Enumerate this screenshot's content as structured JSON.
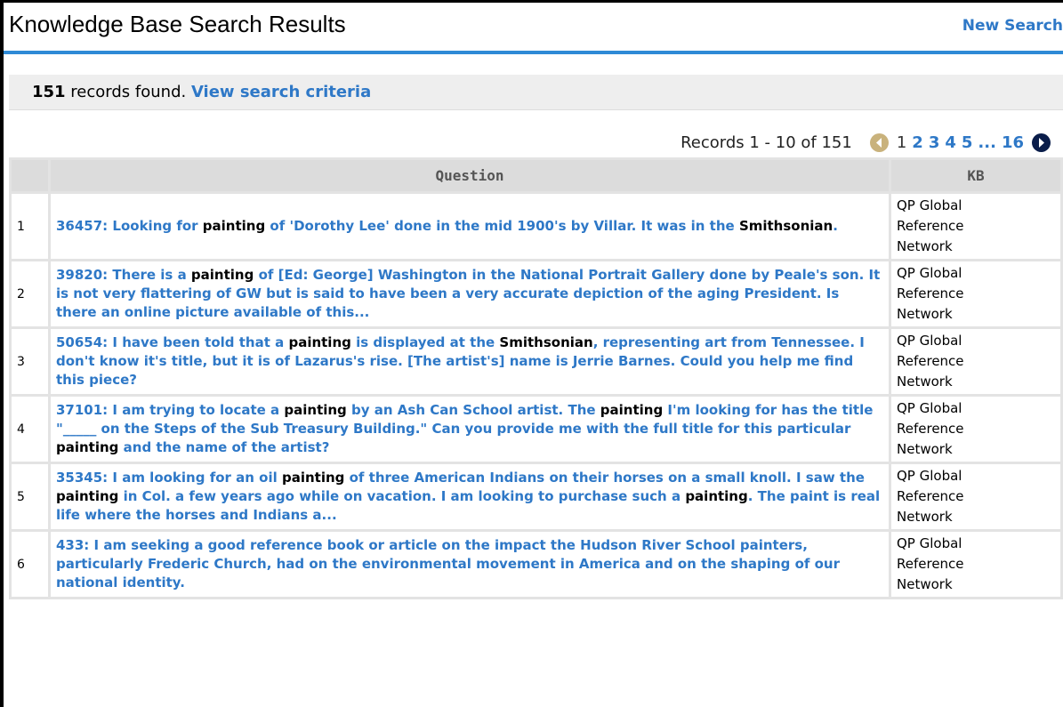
{
  "header": {
    "title": "Knowledge Base Search Results",
    "new_search_label": "New Search"
  },
  "summary": {
    "count": "151",
    "text": " records found. ",
    "criteria_link": "View search criteria"
  },
  "pager": {
    "range_text": "Records 1 - 10 of 151",
    "pages": [
      "1",
      "2",
      "3",
      "4",
      "5"
    ],
    "current_page": "1",
    "ellipsis": "...",
    "last_page": "16",
    "prev_icon": "prev-arrow-icon",
    "next_icon": "next-arrow-icon"
  },
  "table": {
    "columns": {
      "number": "",
      "question": "Question",
      "kb": "KB"
    },
    "rows": [
      {
        "num": "1",
        "segments": [
          {
            "t": "36457: Looking for ",
            "h": false
          },
          {
            "t": "painting",
            "h": true
          },
          {
            "t": " of 'Dorothy Lee' done in the mid 1900's by Villar. It was in the ",
            "h": false
          },
          {
            "t": "Smithsonian",
            "h": true
          },
          {
            "t": ".",
            "h": false
          }
        ],
        "kb": [
          "QP Global",
          "Reference",
          "Network"
        ]
      },
      {
        "num": "2",
        "segments": [
          {
            "t": "39820: There is a ",
            "h": false
          },
          {
            "t": "painting",
            "h": true
          },
          {
            "t": " of [Ed: George] Washington in the National Portrait Gallery done by Peale's son. It is not very flattering of GW but is said to have been a very accurate depiction of the aging President. Is there an online picture available of this...",
            "h": false
          }
        ],
        "kb": [
          "QP Global",
          "Reference",
          "Network"
        ]
      },
      {
        "num": "3",
        "segments": [
          {
            "t": "50654: I have been told that a ",
            "h": false
          },
          {
            "t": "painting",
            "h": true
          },
          {
            "t": " is displayed at the ",
            "h": false
          },
          {
            "t": "Smithsonian",
            "h": true
          },
          {
            "t": ", representing art from Tennessee. I don't know it's title, but it is of Lazarus's rise. [The artist's] name is Jerrie Barnes. Could you help me find this piece?",
            "h": false
          }
        ],
        "kb": [
          "QP Global",
          "Reference",
          "Network"
        ]
      },
      {
        "num": "4",
        "segments": [
          {
            "t": "37101: I am trying to locate a ",
            "h": false
          },
          {
            "t": "painting",
            "h": true
          },
          {
            "t": " by an Ash Can School artist. The ",
            "h": false
          },
          {
            "t": "painting",
            "h": true
          },
          {
            "t": " I'm looking for has the title \"_____ on the Steps of the Sub Treasury Building.\" Can you provide me with the full title for this particular ",
            "h": false
          },
          {
            "t": "painting",
            "h": true
          },
          {
            "t": " and the name of the artist?",
            "h": false
          }
        ],
        "kb": [
          "QP Global",
          "Reference",
          "Network"
        ]
      },
      {
        "num": "5",
        "segments": [
          {
            "t": "35345: I am looking for an oil ",
            "h": false
          },
          {
            "t": "painting",
            "h": true
          },
          {
            "t": " of three American Indians on their horses on a small knoll. I saw the ",
            "h": false
          },
          {
            "t": "painting",
            "h": true
          },
          {
            "t": " in Col. a few years ago while on vacation. I am looking to purchase such a ",
            "h": false
          },
          {
            "t": "painting",
            "h": true
          },
          {
            "t": ". The paint is real life where the horses and Indians a...",
            "h": false
          }
        ],
        "kb": [
          "QP Global",
          "Reference",
          "Network"
        ]
      },
      {
        "num": "6",
        "segments": [
          {
            "t": "433: I am seeking a good reference book or article on the impact the Hudson River School painters, particularly Frederic Church, had on the environmental movement in America and on the shaping of our national identity.",
            "h": false
          }
        ],
        "kb": [
          "QP Global",
          "Reference",
          "Network"
        ]
      }
    ]
  },
  "colors": {
    "link_blue": "#2e78c7",
    "header_rule": "#2e8ad6",
    "prev_arrow": "#c9b27c",
    "next_arrow": "#0a1d4a"
  }
}
